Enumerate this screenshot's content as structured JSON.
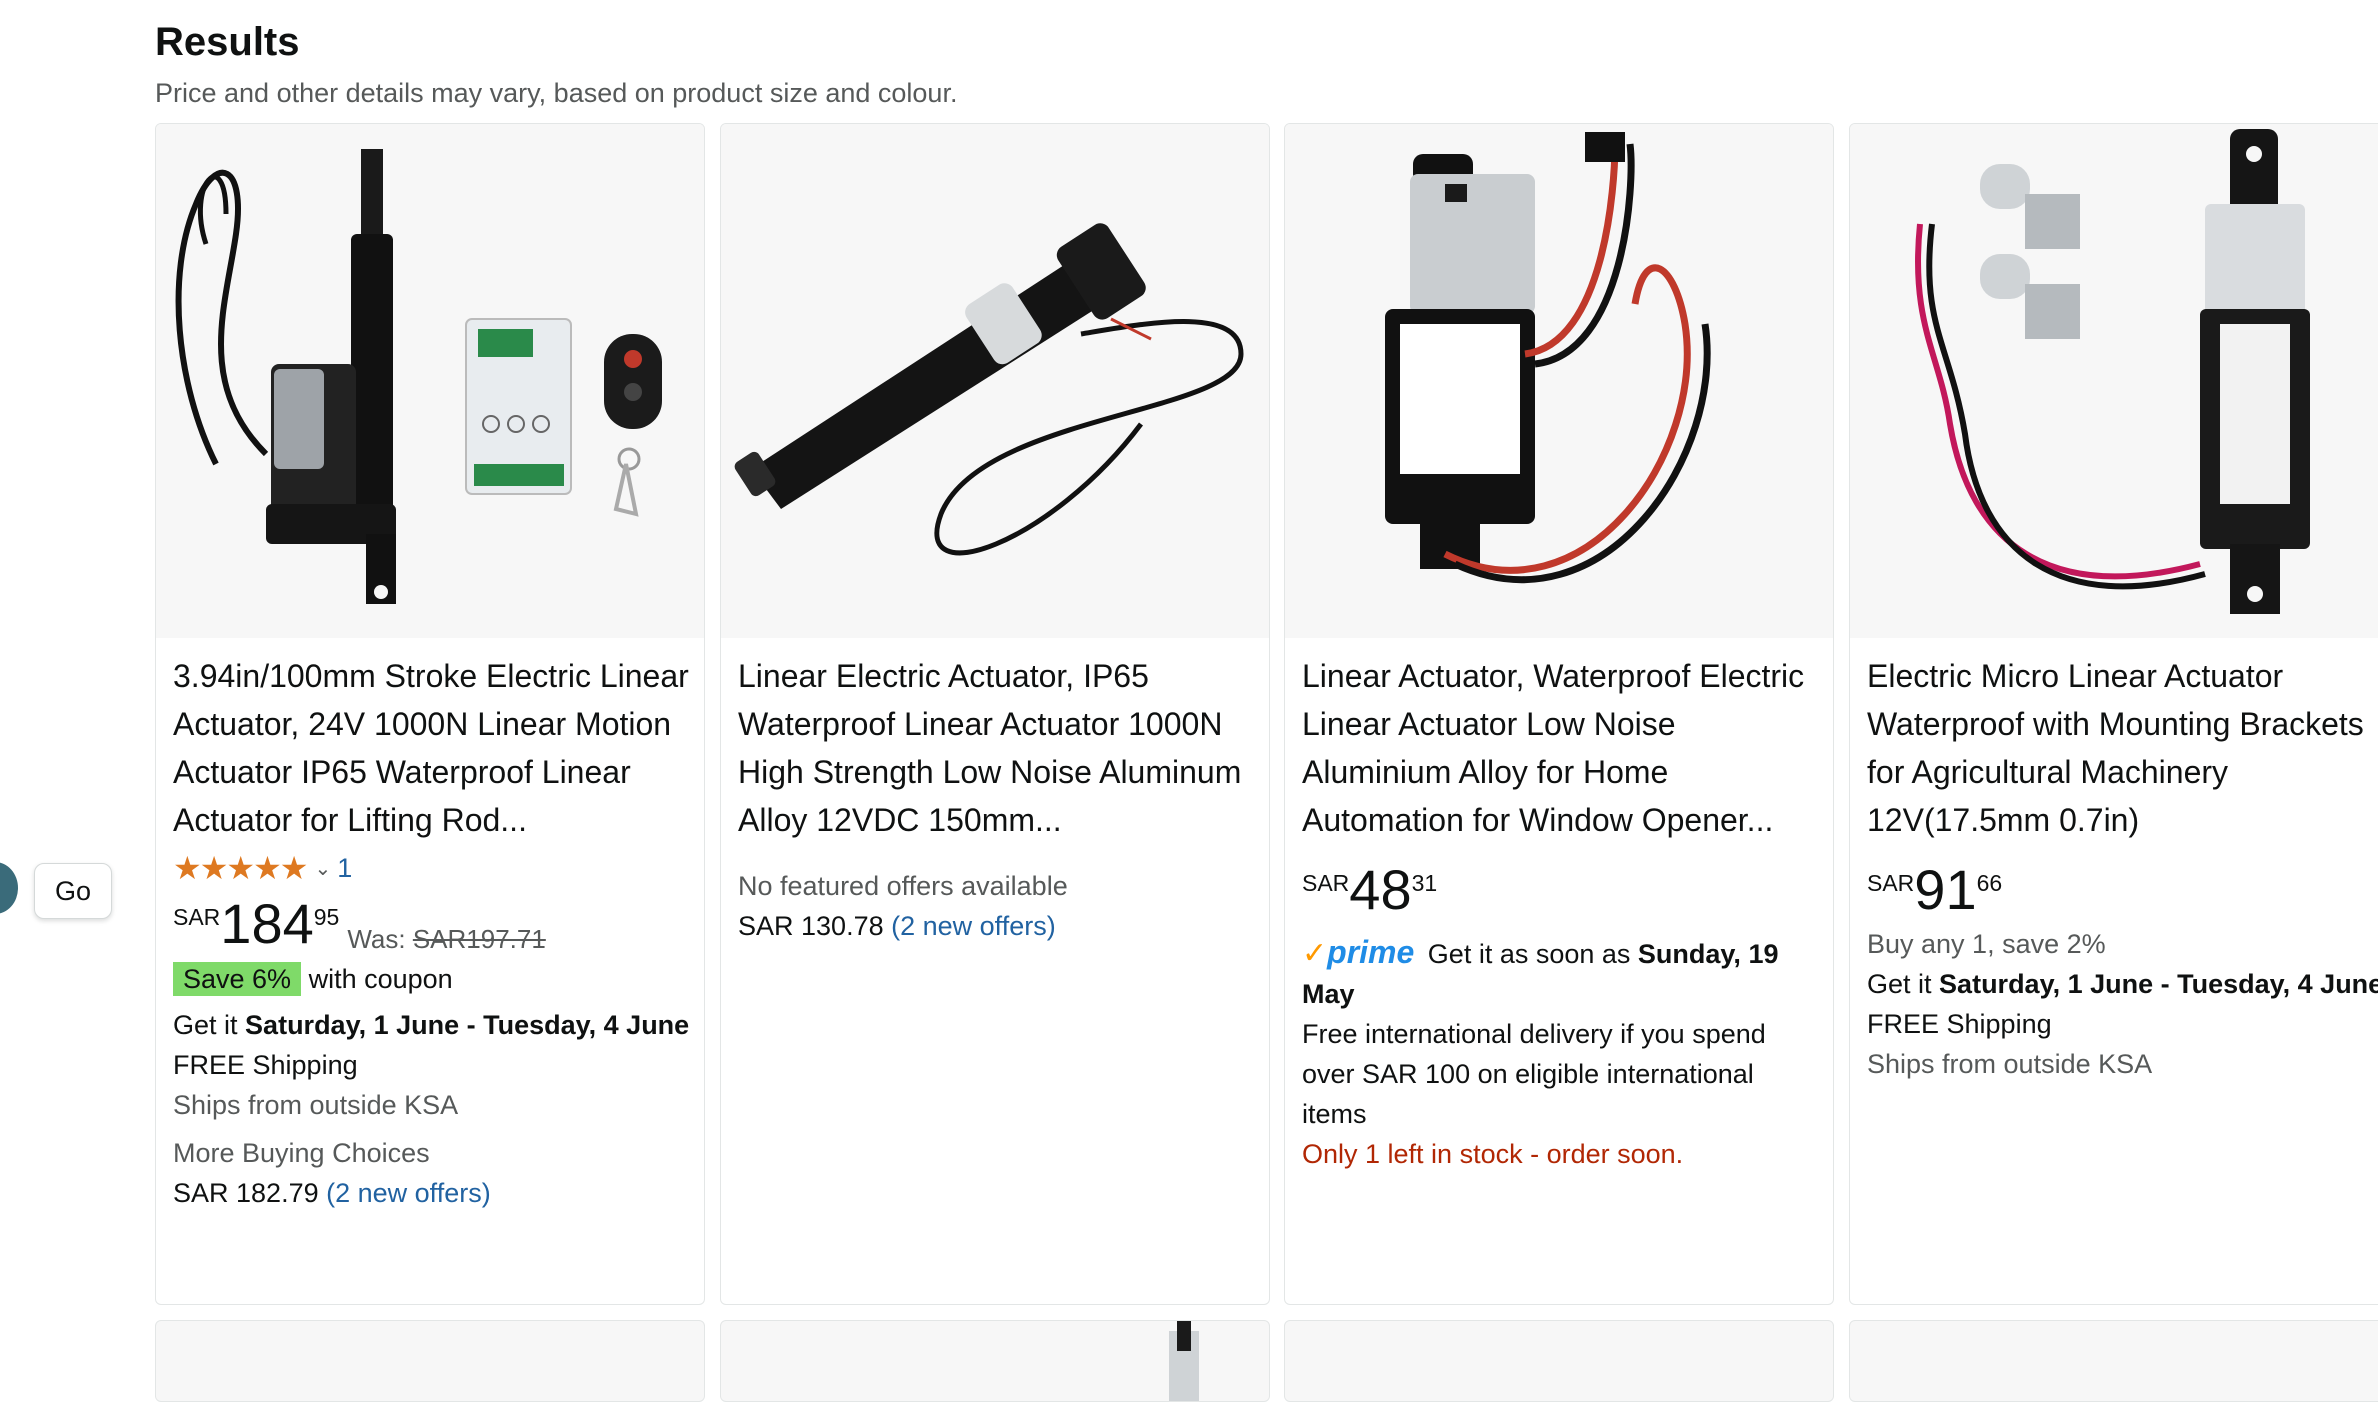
{
  "header": {
    "title": "Results",
    "subtitle": "Price and other details may vary, based on product size and colour."
  },
  "sidebar": {
    "go_label": "Go"
  },
  "products": [
    {
      "title": "3.94in/100mm Stroke Electric Linear Actuator, 24V 1000N Linear Motion Actuator IP65 Waterproof Linear Actuator for Lifting Rod...",
      "rating_count": "1",
      "price_symbol": "SAR",
      "price_whole": "184",
      "price_fraction": "95",
      "was_label": "Was:",
      "was_price": "SAR197.71",
      "coupon_badge": "Save 6%",
      "coupon_text": "with coupon",
      "delivery_prefix": "Get it",
      "delivery_dates": "Saturday, 1 June - Tuesday, 4 June",
      "shipping": "FREE Shipping",
      "ships_from": "Ships from outside KSA",
      "more_choices": "More Buying Choices",
      "alt_price": "SAR 182.79",
      "alt_offers": "(2 new offers)"
    },
    {
      "title": "Linear Electric Actuator, IP65 Waterproof Linear Actuator 1000N High Strength Low Noise Aluminum Alloy 12VDC 150mm...",
      "no_offers": "No featured offers available",
      "alt_price": "SAR 130.78",
      "alt_offers": "(2 new offers)"
    },
    {
      "title": "Linear Actuator, Waterproof Electric Linear Actuator Low Noise Aluminium Alloy for Home Automation for Window Opener...",
      "price_symbol": "SAR",
      "price_whole": "48",
      "price_fraction": "31",
      "prime_check": "✓",
      "prime_label": "prime",
      "delivery_prefix": "Get it as soon as",
      "delivery_dates": "Sunday, 19 May",
      "intl_delivery": "Free international delivery if you spend over SAR 100 on eligible international items",
      "stock": "Only 1 left in stock - order soon."
    },
    {
      "title": "Electric Micro Linear Actuator Waterproof with Mounting Brackets for Agricultural Machinery 12V(17.5mm 0.7in)",
      "price_symbol": "SAR",
      "price_whole": "91",
      "price_fraction": "66",
      "buy_any": "Buy any 1, save 2%",
      "delivery_prefix": "Get it",
      "delivery_dates": "Saturday, 1 June - Tuesday, 4 June",
      "shipping": "FREE Shipping",
      "ships_from": "Ships from outside KSA"
    }
  ],
  "rating": {
    "stars": 5,
    "max": 5,
    "icon": "star-icon"
  },
  "colors": {
    "price_red": "#B12704",
    "link": "#2162a1",
    "prime": "#1F8CE6",
    "coupon": "#7FDA69",
    "star": "#de7921"
  }
}
